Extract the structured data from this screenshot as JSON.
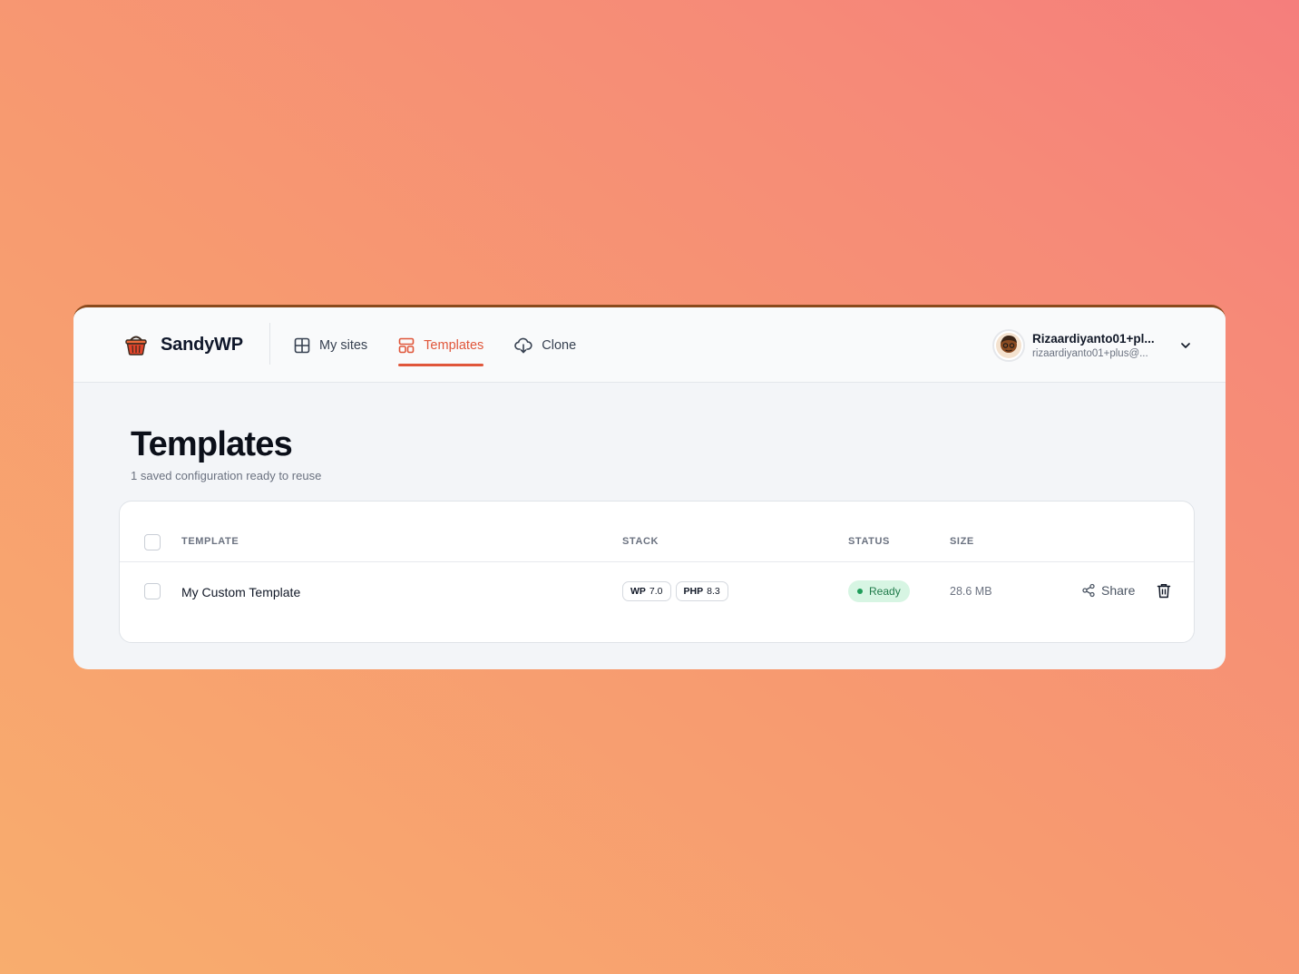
{
  "app": {
    "name": "SandyWP",
    "logo_icon": "basket-icon",
    "accent_color": "#e0563a"
  },
  "nav": {
    "items": [
      {
        "label": "My sites",
        "icon": "grid-icon",
        "active": false
      },
      {
        "label": "Templates",
        "icon": "template-icon",
        "active": true
      },
      {
        "label": "Clone",
        "icon": "cloud-download-icon",
        "active": false
      }
    ]
  },
  "user": {
    "name": "Rizaardiyanto01+pl...",
    "email": "rizaardiyanto01+plus@..."
  },
  "page": {
    "title": "Templates",
    "subtitle": "1 saved configuration ready to reuse"
  },
  "table": {
    "columns": [
      "TEMPLATE",
      "STACK",
      "STATUS",
      "SIZE"
    ],
    "rows": [
      {
        "name": "My Custom Template",
        "stack": [
          {
            "key": "WP",
            "value": "7.0"
          },
          {
            "key": "PHP",
            "value": "8.3"
          }
        ],
        "status": "Ready",
        "size": "28.6 MB",
        "share_label": "Share"
      }
    ]
  }
}
